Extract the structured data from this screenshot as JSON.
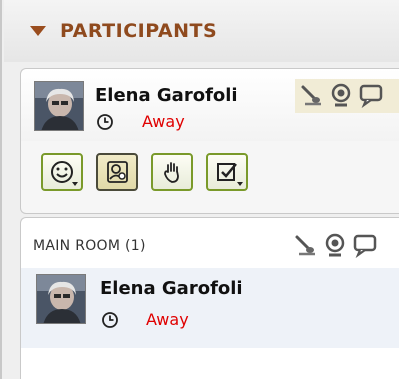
{
  "header": {
    "title": "PARTICIPANTS"
  },
  "self": {
    "name": "Elena Garofoli",
    "status": "Away",
    "status_color": "#e00000",
    "icons": [
      "microphone-icon",
      "webcam-icon",
      "chat-icon"
    ]
  },
  "toolbar": {
    "buttons": [
      {
        "name": "emoticon-button",
        "icon": "smiley-icon",
        "dropdown": true
      },
      {
        "name": "profile-button",
        "icon": "user-card-icon",
        "dropdown": false
      },
      {
        "name": "raise-hand-button",
        "icon": "hand-icon",
        "dropdown": false
      },
      {
        "name": "poll-button",
        "icon": "checkbox-icon",
        "dropdown": true
      }
    ]
  },
  "room": {
    "title": "MAIN ROOM (1)",
    "participants": [
      {
        "name": "Elena Garofoli",
        "status": "Away"
      }
    ]
  },
  "colors": {
    "accent": "#8f4a1e",
    "button_border": "#7a9a2a",
    "away": "#e00000"
  }
}
